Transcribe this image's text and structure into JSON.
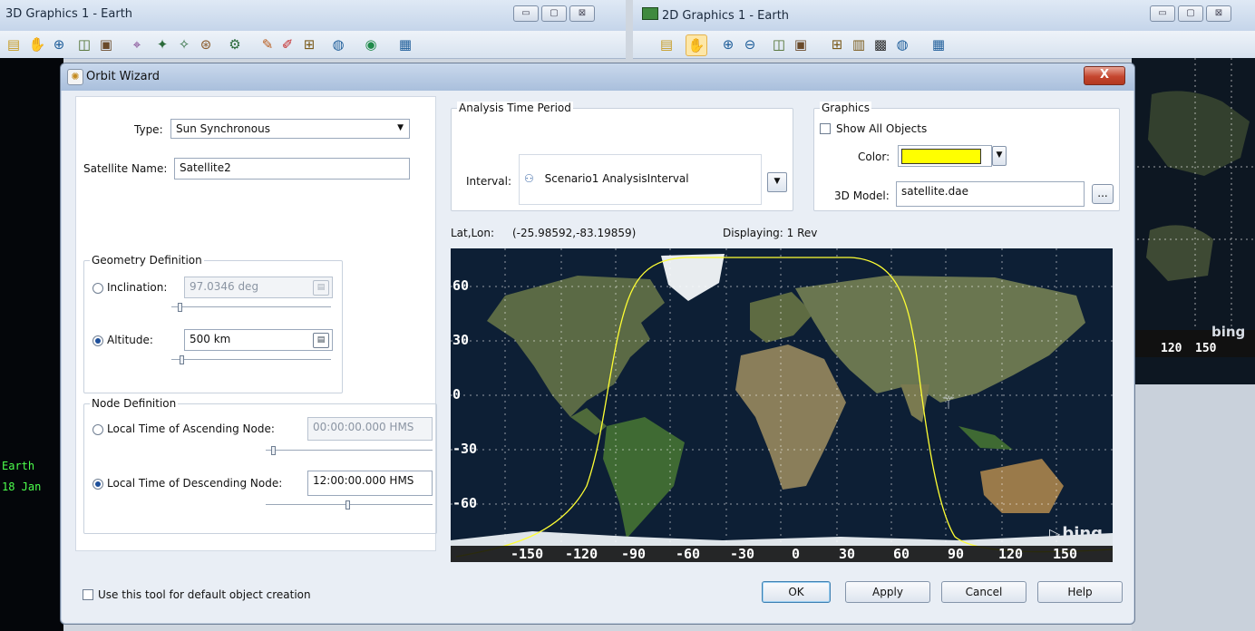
{
  "background": {
    "win3d": {
      "title": "3D Graphics 1 - Earth",
      "min": "▭",
      "max": "▢",
      "close": "⊠"
    },
    "win2d": {
      "title": "2D Graphics 1 - Earth",
      "min": "▭",
      "max": "▢",
      "close": "⊠"
    },
    "left_earth_labels": [
      "Earth",
      "18 Jan"
    ],
    "right_map_ticks": [
      "120",
      "150"
    ],
    "right_map_logo": "bing"
  },
  "dialog": {
    "title": "Orbit Wizard",
    "close_label": "X",
    "type_label": "Type:",
    "type_value": "Sun Synchronous",
    "satellite_name_label": "Satellite Name:",
    "satellite_name_value": "Satellite2",
    "geometry": {
      "title": "Geometry Definition",
      "inclination_label": "Inclination:",
      "inclination_value": "97.0346 deg",
      "altitude_label": "Altitude:",
      "altitude_value": "500 km",
      "selected": "altitude"
    },
    "node": {
      "title": "Node Definition",
      "ascending_label": "Local Time of Ascending Node:",
      "ascending_value": "00:00:00.000 HMS",
      "descending_label": "Local Time of Descending Node:",
      "descending_value": "12:00:00.000 HMS",
      "selected": "descending"
    },
    "analysis": {
      "title": "Analysis Time Period",
      "interval_label": "Interval:",
      "interval_value": "Scenario1 AnalysisInterval"
    },
    "graphics": {
      "title": "Graphics",
      "show_all_label": "Show All Objects",
      "color_label": "Color:",
      "color_value": "#ffff00",
      "model_label": "3D Model:",
      "model_value": "satellite.dae",
      "browse_label": "..."
    },
    "map": {
      "latlon_label": "Lat,Lon:",
      "latlon_value": "(-25.98592,-83.19859)",
      "displaying": "Displaying: 1 Rev",
      "y_ticks": [
        "60",
        "30",
        "0",
        "-30",
        "-60"
      ],
      "x_ticks": [
        "-150",
        "-120",
        "-90",
        "-60",
        "-30",
        "0",
        "30",
        "60",
        "90",
        "120",
        "150"
      ],
      "logo": "bing"
    },
    "default_check_label": "Use this tool for default object creation",
    "buttons": {
      "ok": "OK",
      "apply": "Apply",
      "cancel": "Cancel",
      "help": "Help"
    }
  }
}
